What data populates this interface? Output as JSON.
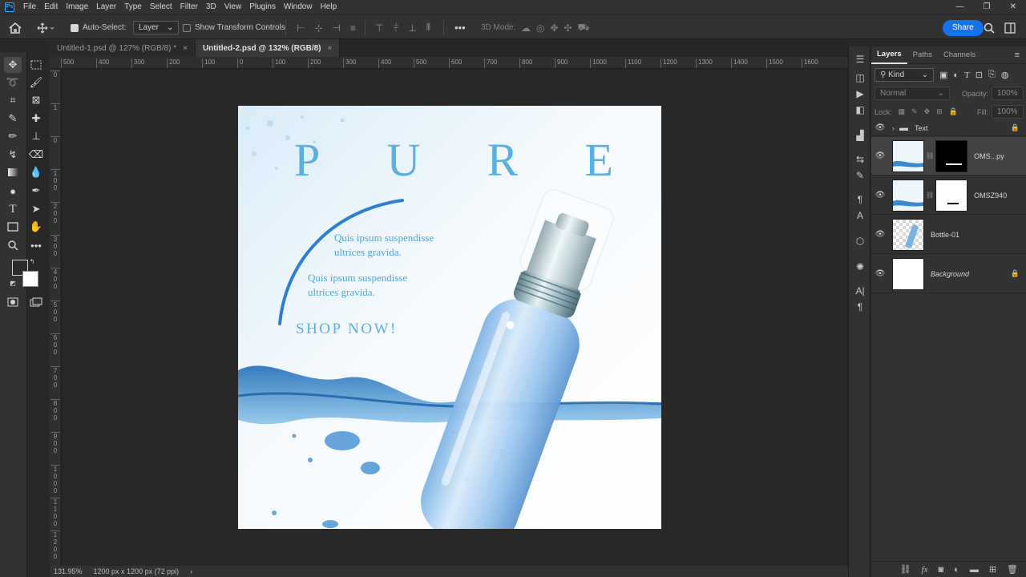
{
  "app": {
    "logo": "Ps",
    "menu": [
      "File",
      "Edit",
      "Image",
      "Layer",
      "Type",
      "Select",
      "Filter",
      "3D",
      "View",
      "Plugins",
      "Window",
      "Help"
    ],
    "window_controls": [
      "—",
      "❐",
      "✕"
    ]
  },
  "options": {
    "auto_select_label": "Auto-Select:",
    "auto_select_value": "Layer",
    "transform_label": "Show Transform Controls",
    "mode_3d_label": "3D Mode:",
    "share_label": "Share",
    "more": "•••"
  },
  "tabs": [
    {
      "label": "Untitled-1.psd @ 127% (RGB/8) *",
      "close": "×"
    },
    {
      "label": "Untitled-2.psd @ 132% (RGB/8)",
      "close": "×"
    }
  ],
  "ruler": {
    "h_ticks": [
      "500",
      "400",
      "300",
      "200",
      "100",
      "0",
      "100",
      "200",
      "300",
      "400",
      "500",
      "600",
      "700",
      "800",
      "900",
      "1000",
      "1100",
      "1200",
      "1300",
      "1400",
      "1500",
      "1600"
    ],
    "v_ticks": [
      "0",
      "1",
      "0",
      "1 0 0",
      "2 0 0",
      "3 0 0",
      "4 0 0",
      "5 0 0",
      "6 0 0",
      "7 0 0",
      "8 0 0",
      "9 0 0",
      "1 0 0 0",
      "1 1 0 0",
      "1 2 0 0"
    ]
  },
  "artwork": {
    "title_letters": [
      "P",
      "U",
      "R",
      "E"
    ],
    "line1": "Quis ipsum suspendisse",
    "line2": "ultrices gravida.",
    "line3": "Quis ipsum suspendisse",
    "line4": "ultrices gravida.",
    "cta": "SHOP NOW!",
    "accent_color": "#5ab0e0",
    "body_text_color": "#4fa7da"
  },
  "status": {
    "zoom": "131.95%",
    "doc_size": "1200 px x 1200 px (72 ppi)",
    "arrow": "›"
  },
  "layers_panel": {
    "tabs": [
      "Layers",
      "Paths",
      "Channels"
    ],
    "filter_label": "Kind",
    "blend_mode": "Normal",
    "opacity_label": "Opacity:",
    "opacity_value": "100%",
    "lock_label": "Lock:",
    "fill_label": "Fill:",
    "fill_value": "100%",
    "layers": [
      {
        "name": "Text",
        "type": "group"
      },
      {
        "name": "OMS...py",
        "type": "masked"
      },
      {
        "name": "OMSZ940",
        "type": "masked"
      },
      {
        "name": "Bottle-01",
        "type": "pixel"
      },
      {
        "name": "Background",
        "type": "background"
      }
    ]
  }
}
